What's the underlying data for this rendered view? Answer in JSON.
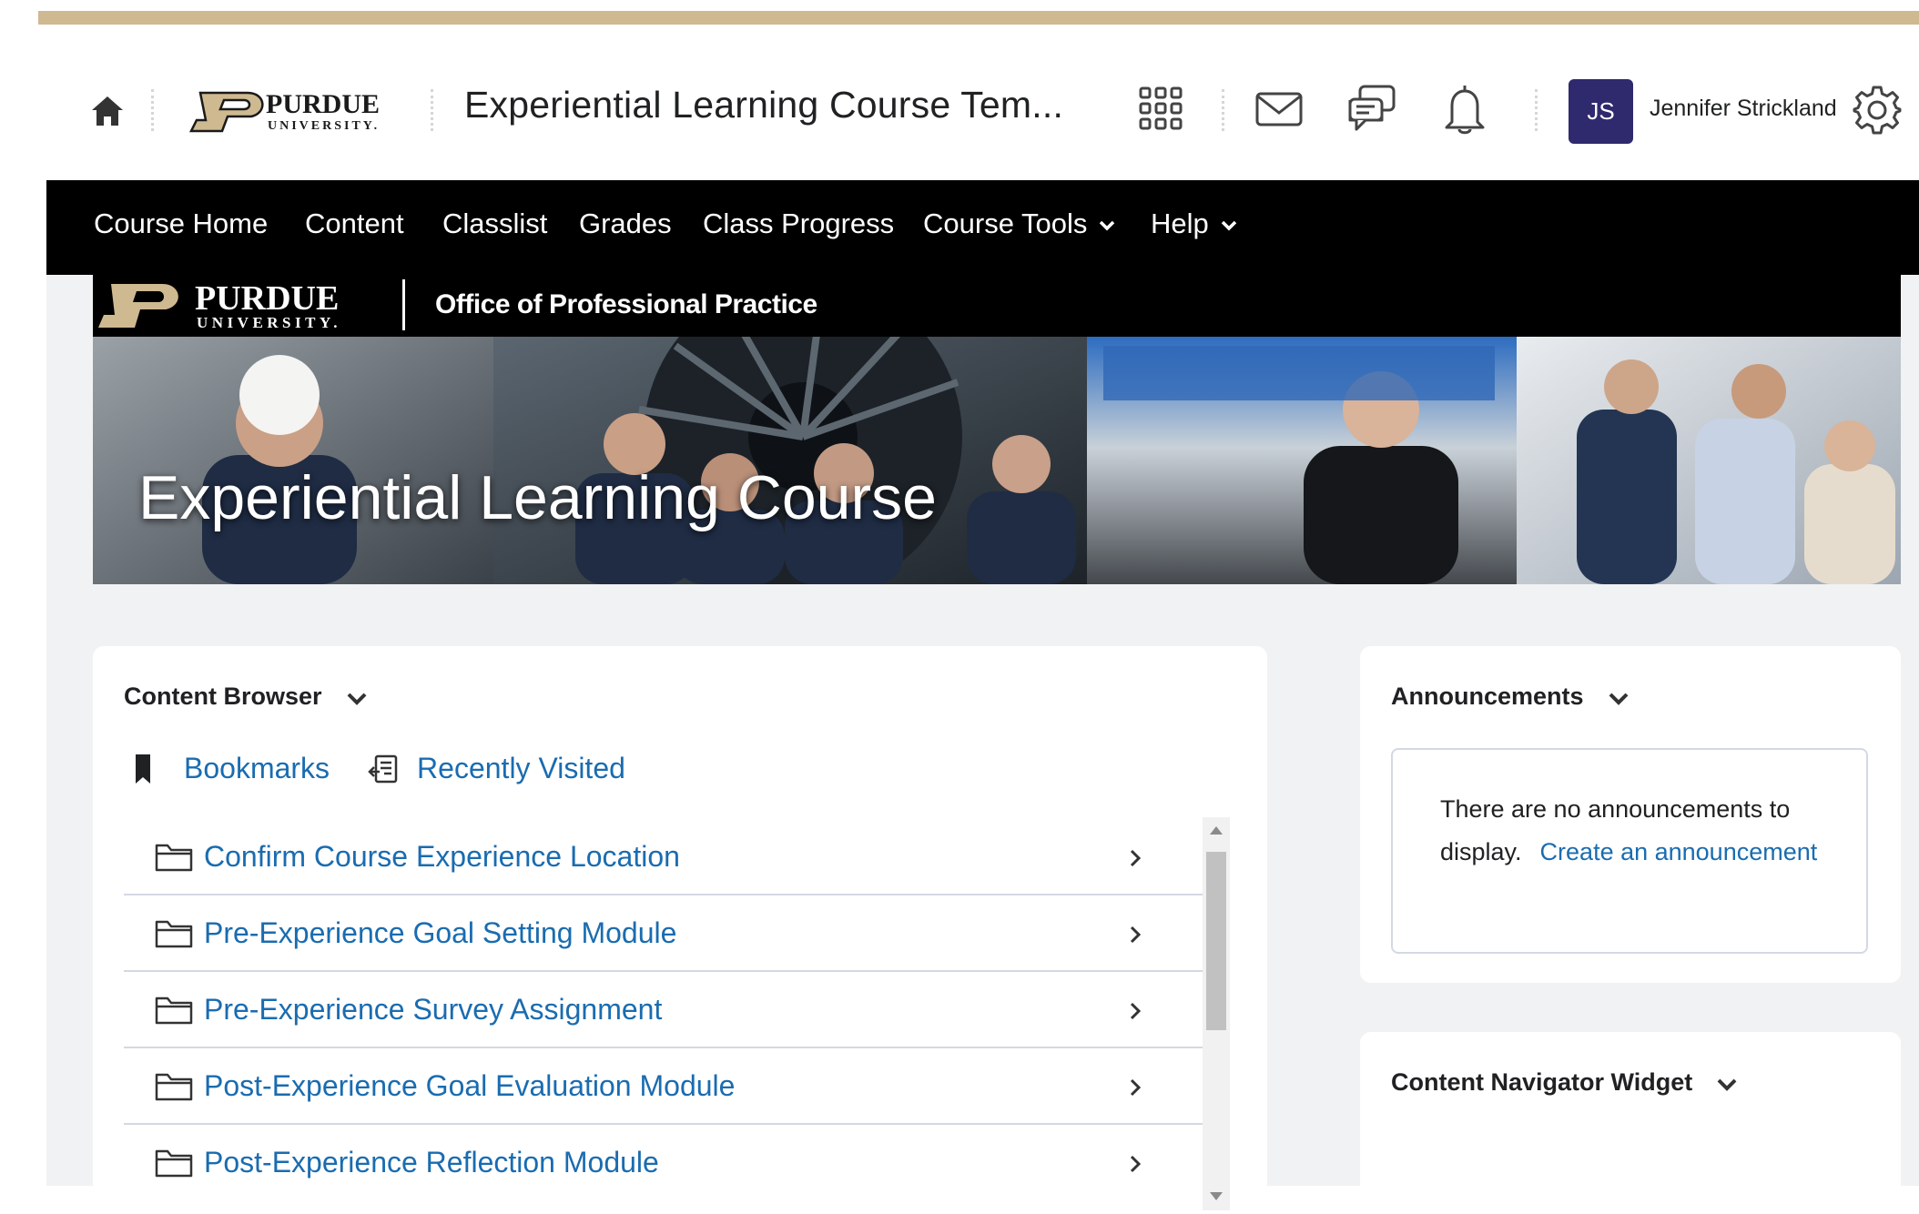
{
  "header": {
    "logo_text": "PURDUE UNIVERSITY",
    "course_title": "Experiential Learning Course Tem...",
    "user_initials": "JS",
    "user_name": "Jennifer Strickland"
  },
  "nav": {
    "items": [
      {
        "label": "Course Home"
      },
      {
        "label": "Content"
      },
      {
        "label": "Classlist"
      },
      {
        "label": "Grades"
      },
      {
        "label": "Class Progress"
      },
      {
        "label": "Course Tools",
        "has_dropdown": true
      },
      {
        "label": "Help",
        "has_dropdown": true
      }
    ]
  },
  "banner": {
    "logo_text": "PURDUE UNIVERSITY",
    "office": "Office of Professional Practice",
    "title": "Experiential Learning Course"
  },
  "content_browser": {
    "title": "Content Browser",
    "bookmarks_label": "Bookmarks",
    "recently_visited_label": "Recently Visited",
    "modules": [
      {
        "label": "Confirm Course Experience Location"
      },
      {
        "label": "Pre-Experience Goal Setting Module"
      },
      {
        "label": "Pre-Experience Survey Assignment"
      },
      {
        "label": "Post-Experience Goal Evaluation Module"
      },
      {
        "label": "Post-Experience Reflection Module"
      }
    ]
  },
  "announcements": {
    "title": "Announcements",
    "empty_text": "There are no announcements to display.",
    "create_link": "Create an announcement"
  },
  "content_navigator": {
    "title": "Content Navigator Widget"
  },
  "colors": {
    "gold": "#cfb991",
    "link": "#1a6cb0",
    "avatar_bg": "#2f2a6e",
    "nav_bg": "#000000",
    "page_bg": "#f1f2f3"
  },
  "icons": [
    "home-icon",
    "waffle-icon",
    "mail-icon",
    "chat-icon",
    "bell-icon",
    "gear-icon",
    "bookmark-icon",
    "recently-visited-icon",
    "folder-icon",
    "chevron-right-icon",
    "chevron-down-icon"
  ]
}
